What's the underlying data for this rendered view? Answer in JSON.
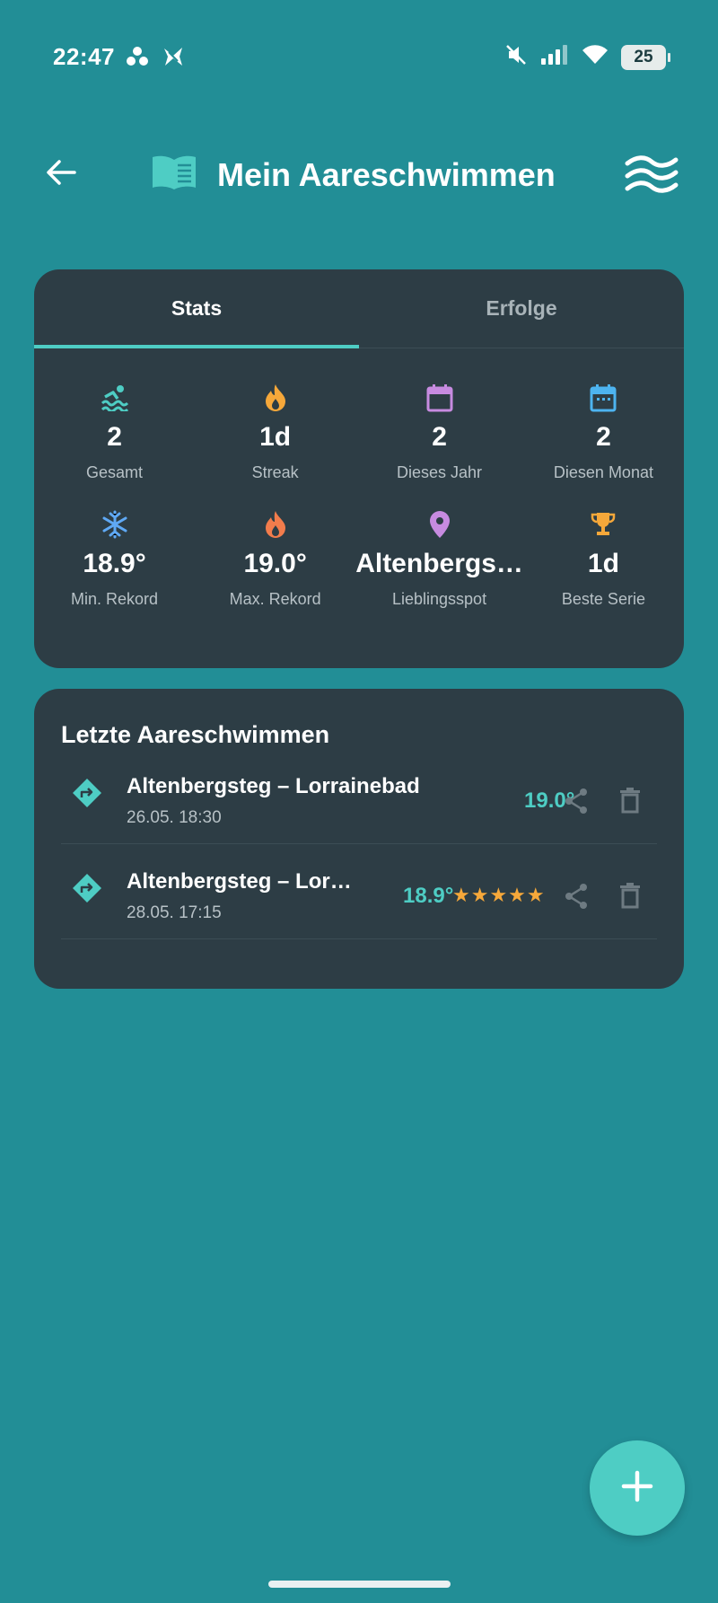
{
  "status_bar": {
    "time": "22:47",
    "battery": "25",
    "icons": [
      "dots-app-icon",
      "pinwheel-app-icon",
      "mute-vibrate-icon",
      "signal-icon",
      "wifi-icon",
      "battery-icon"
    ]
  },
  "header": {
    "title": "Mein Aareschwimmen",
    "back_icon": "arrow-left-icon",
    "book_icon": "book-icon",
    "menu_icon": "waves-icon"
  },
  "tabs": [
    {
      "label": "Stats",
      "active": true
    },
    {
      "label": "Erfolge",
      "active": false
    }
  ],
  "stats": [
    {
      "icon": "swimmer-icon",
      "value": "2",
      "label": "Gesamt",
      "color": "#4ecdc4"
    },
    {
      "icon": "flame-icon",
      "value": "1d",
      "label": "Streak",
      "color": "#f6a83a"
    },
    {
      "icon": "calendar-icon",
      "value": "2",
      "label": "Dieses Jahr",
      "color": "#c78be0"
    },
    {
      "icon": "calendar-month-icon",
      "value": "2",
      "label": "Diesen Monat",
      "color": "#4db4f0"
    },
    {
      "icon": "snowflake-icon",
      "value": "18.9°",
      "label": "Min. Rekord",
      "color": "#5fa9f5"
    },
    {
      "icon": "fire-icon",
      "value": "19.0°",
      "label": "Max. Rekord",
      "color": "#f27c4c"
    },
    {
      "icon": "location-pin-icon",
      "value": "Altenbergs…",
      "label": "Lieblingsspot",
      "color": "#c78be0"
    },
    {
      "icon": "trophy-icon",
      "value": "1d",
      "label": "Beste Serie",
      "color": "#f6a83a"
    }
  ],
  "recent": {
    "title": "Letzte Aareschwimmen",
    "entries": [
      {
        "name": "Altenbergsteg – Lorrainebad",
        "date": "26.05. 18:30",
        "temp": "19.0°",
        "stars": ""
      },
      {
        "name": "Altenbergsteg – Lor…",
        "date": "28.05. 17:15",
        "temp": "18.9°",
        "stars": "★★★★★"
      }
    ]
  },
  "fab": {
    "icon": "plus-icon"
  },
  "colors": {
    "background": "#228e96",
    "card": "#2d3d45",
    "accent": "#4ecdc4",
    "star": "#f6a83a"
  }
}
